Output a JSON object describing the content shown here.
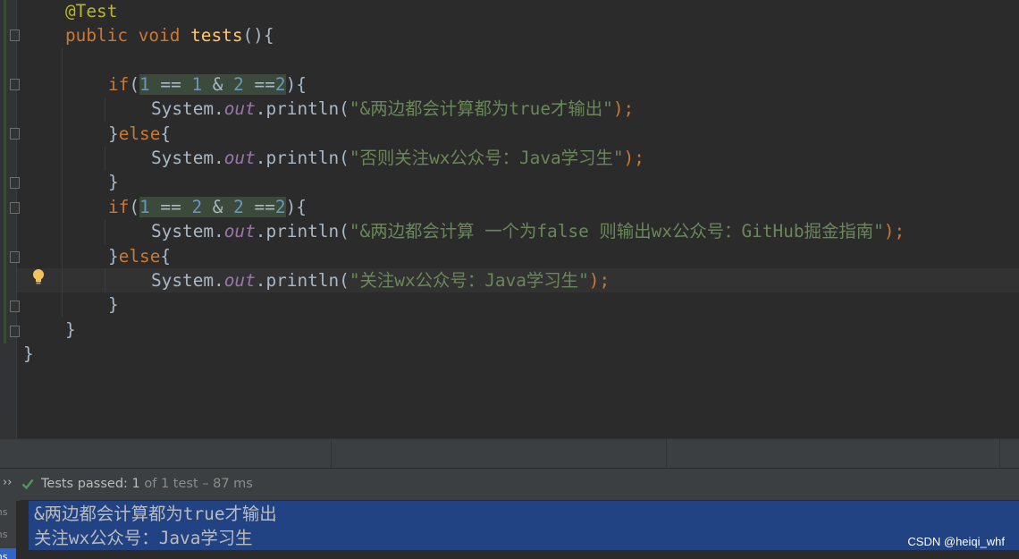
{
  "editor": {
    "lines": {
      "l1": {
        "annotation": "@Test"
      },
      "l2": {
        "kw1": "public",
        "kw2": "void",
        "fn": "tests",
        "rest": "(){"
      },
      "l4": {
        "kw": "if",
        "open": "(",
        "n1": "1",
        "op1": " == ",
        "n2": "1",
        "op2": " & ",
        "n3": "2",
        "op3": " ==",
        "n4": "2",
        "close": "){"
      },
      "l5": {
        "pre": "System.",
        "field": "out",
        "mid": ".println(",
        "str": "\"&两边都会计算都为true才输出\"",
        "end": ");"
      },
      "l6": {
        "brace": "}",
        "kw": "else",
        "open": "{"
      },
      "l7": {
        "pre": "System.",
        "field": "out",
        "mid": ".println(",
        "str": "\"否则关注wx公众号：Java学习生\"",
        "end": ");"
      },
      "l8": {
        "brace": "}"
      },
      "l9": {
        "kw": "if",
        "open": "(",
        "n1": "1",
        "op1": " == ",
        "n2": "2",
        "op2": " & ",
        "n3": "2",
        "op3": " ==",
        "n4": "2",
        "close": "){"
      },
      "l10": {
        "pre": "System.",
        "field": "out",
        "mid": ".println(",
        "str": "\"&两边都会计算 一个为false 则输出wx公众号：GitHub掘金指南\"",
        "end": ");"
      },
      "l11": {
        "brace": "}",
        "kw": "else",
        "open": "{"
      },
      "l12": {
        "pre": "System.",
        "field": "out",
        "mid": ".println(",
        "str": "\"关注wx公众号：Java学习生\"",
        "end": ");"
      },
      "l13": {
        "brace": "}"
      },
      "l14": {
        "brace": "}"
      },
      "l15": {
        "brace": "}"
      }
    }
  },
  "test_status": {
    "label": "Tests passed:",
    "passed": "1",
    "detail": "of 1 test – 87 ms"
  },
  "left_panel": {
    "items": [
      "ms",
      "ms",
      "ms"
    ]
  },
  "console": {
    "lines": [
      "&两边都会计算都为true才输出",
      "关注wx公众号：Java学习生"
    ]
  },
  "watermark": "CSDN @heiqi_whf",
  "colors": {
    "background": "#2b2b2b",
    "keyword": "#cc7832",
    "string": "#6a8759",
    "number": "#6897bb",
    "selection": "#214283",
    "pass_green": "#499c54"
  }
}
